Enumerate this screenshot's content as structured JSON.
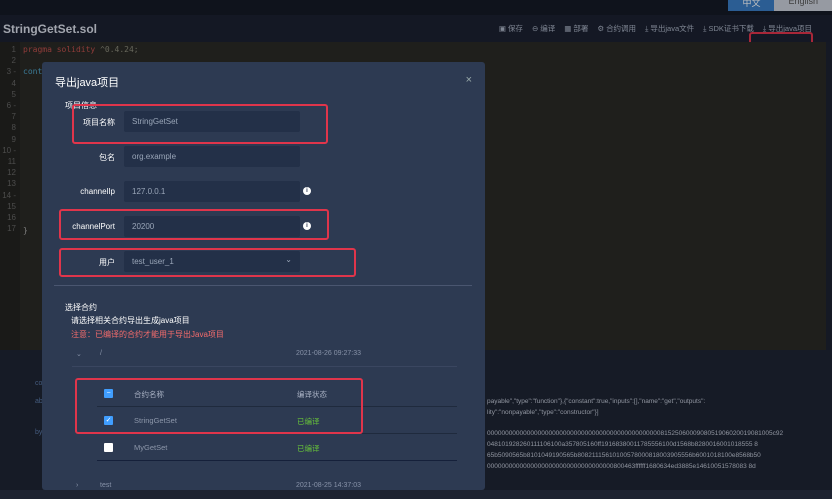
{
  "topbar": {
    "lang_active": "中文",
    "lang_other": "English"
  },
  "file": {
    "name": "StringGetSet.sol"
  },
  "toolbar": [
    {
      "icon": "save-icon",
      "glyph": "▣",
      "label": "保存"
    },
    {
      "icon": "compile-icon",
      "glyph": "⊖",
      "label": "编译"
    },
    {
      "icon": "deploy-icon",
      "glyph": "▦",
      "label": "部署"
    },
    {
      "icon": "call-icon",
      "glyph": "⚙",
      "label": "合约调用"
    },
    {
      "icon": "download-icon",
      "glyph": "⤓",
      "label": "导出java文件"
    },
    {
      "icon": "download-icon",
      "glyph": "⤓",
      "label": "SDK证书下载"
    },
    {
      "icon": "download-icon",
      "glyph": "⤓",
      "label": "导出java项目"
    }
  ],
  "editor": {
    "line_numbers": [
      "1",
      "2",
      "3 -",
      "4",
      "5",
      "6 -",
      "7",
      "8",
      "9",
      "10 -",
      "11",
      "12",
      "13",
      "14 -",
      "15",
      "16",
      "17"
    ],
    "line1_keyword": "pragma solidity",
    "line1_version": " ^0.4.24;",
    "line3": "cont",
    "line17": "}"
  },
  "lower": {
    "side_labels": [
      "co",
      "ab",
      "by"
    ],
    "abi_lines": [
      "payable\",\"type\":\"function\"},{\"constant\":true,\"inputs\":[],\"name\":\"get\",\"outputs\":",
      "lity\":\"nonpayable\",\"type\":\"constructor\"}]"
    ],
    "bytecode_lines": [
      "0000000000000000000000000000000000000000000000008152506000908051906020019081005c92",
      "048101928260111106100a357805160ff19168380011785556100d1568b8280016001018555 8",
      "65b5090565b8101049190565b80821115610100578000818003905556b6001018100e8568b50",
      "00000000000000000000000000000000000800463ffffff1680634ed3885e14610051578083 8d"
    ]
  },
  "modal": {
    "title": "导出java项目",
    "close": "×",
    "section_info": "项目信息",
    "fields": [
      {
        "label": "项目名称",
        "value": "StringGetSet",
        "info": false
      },
      {
        "label": "包名",
        "value": "org.example",
        "info": false
      },
      {
        "label": "channelIp",
        "value": "127.0.0.1",
        "info": true
      },
      {
        "label": "channelPort",
        "value": "20200",
        "info": true
      },
      {
        "label": "用户",
        "value": "test_user_1",
        "info": false,
        "dropdown": true
      }
    ],
    "section_contract": "选择合约",
    "hint": "请选择相关合约导出生成java项目",
    "warning": "注意：已编译的合约才能用于导出Java项目",
    "groups": [
      {
        "name": "/",
        "time": "2021-08-26 09:27:33",
        "expanded": true
      },
      {
        "name": "test",
        "time": "2021-08-25 14:37:03",
        "expanded": false
      }
    ],
    "table": {
      "col_name": "合约名称",
      "col_status": "编译状态",
      "rows": [
        {
          "name": "StringGetSet",
          "status": "已编译",
          "checked": true
        },
        {
          "name": "MyGetSet",
          "status": "已编译",
          "checked": false
        }
      ]
    },
    "colors": {
      "accent": "#409eff",
      "success": "#67c23a",
      "warning": "#f56c6c",
      "highlight": "#e0354b"
    }
  }
}
